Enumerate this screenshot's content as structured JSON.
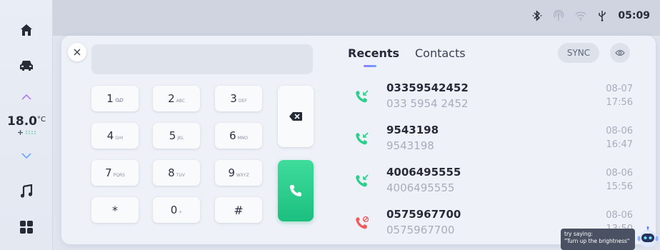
{
  "status": {
    "time": "05:09",
    "icons": [
      "bluetooth-icon",
      "hotspot-icon",
      "wifi-icon",
      "usb-icon"
    ]
  },
  "sidebar": {
    "temperature_value": "18.0",
    "temperature_unit": "°C",
    "icons": [
      "home-icon",
      "car-icon",
      "chevron-up-icon",
      "fan-icon",
      "chevron-down-icon",
      "music-icon",
      "apps-grid-icon"
    ]
  },
  "dialer": {
    "display_value": "",
    "keys": [
      {
        "digit": "1",
        "letters": "ᴏᴏ"
      },
      {
        "digit": "2",
        "letters": "ABC"
      },
      {
        "digit": "3",
        "letters": "DEF"
      },
      {
        "digit": "4",
        "letters": "GHI"
      },
      {
        "digit": "5",
        "letters": "JKL"
      },
      {
        "digit": "6",
        "letters": "MNO"
      },
      {
        "digit": "7",
        "letters": "PQRS"
      },
      {
        "digit": "8",
        "letters": "TUV"
      },
      {
        "digit": "9",
        "letters": "WXYZ"
      },
      {
        "digit": "*",
        "letters": ""
      },
      {
        "digit": "0",
        "letters": "+"
      },
      {
        "digit": "#",
        "letters": ""
      }
    ]
  },
  "tabs": {
    "recents": "Recents",
    "contacts": "Contacts",
    "sync": "SYNC"
  },
  "recents": [
    {
      "name": "03359542452",
      "number": "033 5954 2452",
      "date": "08-07",
      "time": "17:56",
      "type": "incoming"
    },
    {
      "name": "9543198",
      "number": "9543198",
      "date": "08-06",
      "time": "16:47",
      "type": "incoming"
    },
    {
      "name": "4006495555",
      "number": "4006495555",
      "date": "08-06",
      "time": "15:56",
      "type": "incoming"
    },
    {
      "name": "0575967700",
      "number": "0575967700",
      "date": "08-06",
      "time": "13:50",
      "type": "missed"
    }
  ],
  "assistant": {
    "line1": "try saying:",
    "line2": "\"Turn up the brightness\""
  },
  "colors": {
    "call_green": "#1cbf7f",
    "missed_red": "#f05a5a",
    "accent_purple": "#8f7cff"
  }
}
